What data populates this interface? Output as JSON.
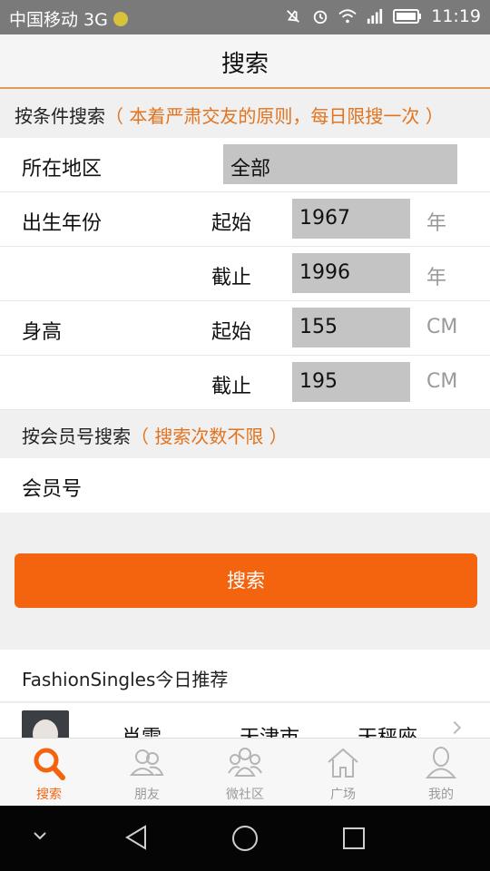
{
  "status_bar": {
    "carrier": "中国移动 3G",
    "network_badge": "3G",
    "time": "11:19",
    "icons": [
      "mute-icon",
      "alarm-icon",
      "wifi-icon",
      "signal-icon",
      "battery-icon"
    ]
  },
  "header": {
    "title": "搜索"
  },
  "condition_search": {
    "title": "按条件搜索",
    "note": "（ 本着严肃交友的原则，每日限搜一次 ）",
    "region": {
      "label": "所在地区",
      "value": "全部"
    },
    "birth_year": {
      "label": "出生年份",
      "from_label": "起始",
      "from_value": "1967",
      "from_unit": "年",
      "to_label": "截止",
      "to_value": "1996",
      "to_unit": "年"
    },
    "height": {
      "label": "身高",
      "from_label": "起始",
      "from_value": "155",
      "from_unit": "CM",
      "to_label": "截止",
      "to_value": "195",
      "to_unit": "CM"
    }
  },
  "member_search": {
    "title": "按会员号搜索",
    "note": "（ 搜索次数不限 ）",
    "field_label": "会员号"
  },
  "search_button": {
    "label": "搜索"
  },
  "recommend": {
    "title": "FashionSingles今日推荐",
    "items": [
      {
        "name": "肖雪",
        "city": "天津市",
        "sign": "天秤座"
      }
    ]
  },
  "tabs": [
    {
      "label": "搜索",
      "icon": "search-icon",
      "active": true
    },
    {
      "label": "朋友",
      "icon": "friends-icon",
      "active": false
    },
    {
      "label": "微社区",
      "icon": "community-icon",
      "active": false
    },
    {
      "label": "广场",
      "icon": "plaza-icon",
      "active": false
    },
    {
      "label": "我的",
      "icon": "profile-icon",
      "active": false
    }
  ],
  "colors": {
    "accent": "#f4640f",
    "note": "#e2731f",
    "field": "#c4c4c4"
  }
}
